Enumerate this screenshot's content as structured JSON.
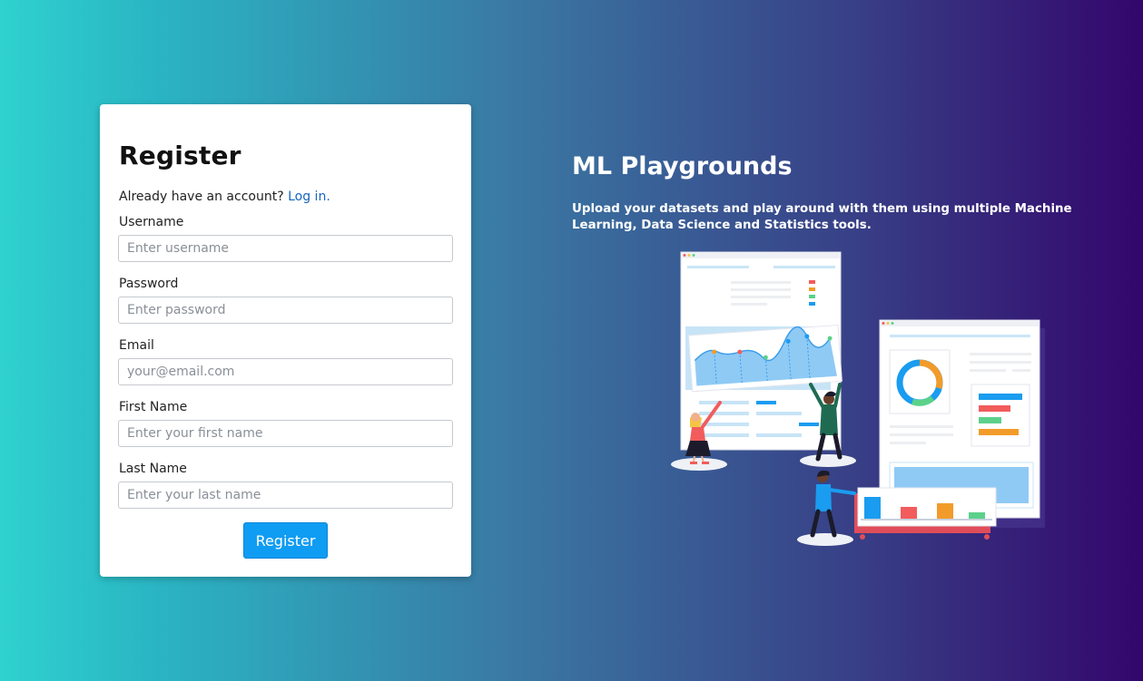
{
  "register": {
    "title": "Register",
    "login_prompt": "Already have an account?",
    "login_link": "Log in.",
    "fields": [
      {
        "label": "Username",
        "placeholder": "Enter username",
        "value": ""
      },
      {
        "label": "Password",
        "placeholder": "Enter password",
        "value": ""
      },
      {
        "label": "Email",
        "placeholder": "your@email.com",
        "value": ""
      },
      {
        "label": "First Name",
        "placeholder": "Enter your first name",
        "value": ""
      },
      {
        "label": "Last Name",
        "placeholder": "Enter your last name",
        "value": ""
      }
    ],
    "submit_label": "Register"
  },
  "hero": {
    "title": "ML Playgrounds",
    "subtitle": "Upload your datasets and play around with them using multiple Machine Learning, Data Science and Statistics tools."
  },
  "colors": {
    "primary_button": "#0f9cf3",
    "link": "#1565c0",
    "gradient_start": "#2fd2cf",
    "gradient_end": "#33066c"
  },
  "icons": {
    "illustration": "team-analyzing-charts-illustration"
  }
}
